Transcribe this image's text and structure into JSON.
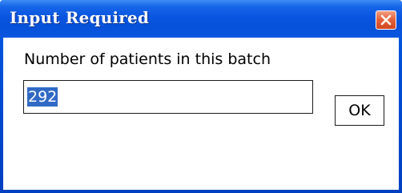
{
  "window": {
    "title": "Input Required"
  },
  "dialog": {
    "prompt": "Number of patients in this batch",
    "input_value": "292",
    "ok_label": "OK"
  },
  "icons": {
    "close": "close-icon"
  },
  "colors": {
    "titlebar": "#0a55e0",
    "close_button": "#e5643e",
    "selection": "#316ac5"
  }
}
